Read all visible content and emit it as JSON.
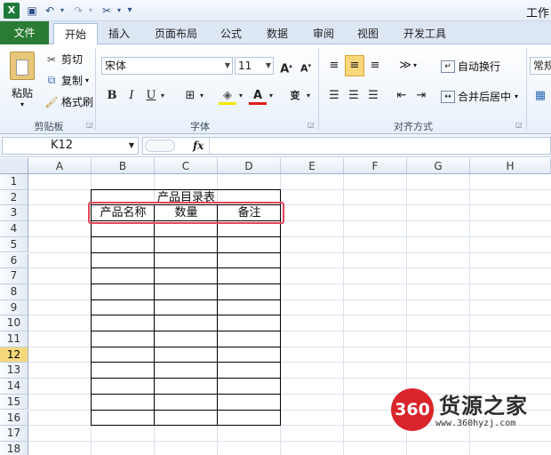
{
  "title_partial": "工作",
  "tabs": {
    "file": "文件",
    "home": "开始",
    "insert": "插入",
    "page_layout": "页面布局",
    "formulas": "公式",
    "data": "数据",
    "review": "审阅",
    "view": "视图",
    "developer": "开发工具"
  },
  "clipboard": {
    "paste": "粘贴",
    "cut": "剪切",
    "copy": "复制",
    "format_painter": "格式刷",
    "group": "剪贴板"
  },
  "font": {
    "name": "宋体",
    "size": "11",
    "bold": "B",
    "italic": "I",
    "underline": "U",
    "group": "字体",
    "grow": "A",
    "shrink": "A",
    "font_color": "A",
    "phonetic": "变"
  },
  "alignment": {
    "wrap_text": "自动换行",
    "merge_center": "合并后居中",
    "group": "对齐方式"
  },
  "number": {
    "format": "常规"
  },
  "formula_bar": {
    "name_box": "K12",
    "fx": "fx",
    "formula": ""
  },
  "columns": [
    "A",
    "B",
    "C",
    "D",
    "E",
    "F",
    "G",
    "H"
  ],
  "rows": [
    "1",
    "2",
    "3",
    "4",
    "5",
    "6",
    "7",
    "8",
    "9",
    "10",
    "11",
    "12",
    "13",
    "14",
    "15",
    "16",
    "17",
    "18"
  ],
  "selected_row": "12",
  "sheet": {
    "table_title": "产品目录表",
    "headers": [
      "产品名称",
      "数量",
      "备注"
    ]
  },
  "watermark": {
    "badge": "360",
    "title": "货源之家",
    "url": "www.360hyzj.com"
  },
  "colors": {
    "file_tab": "#2a7b33",
    "highlight_box": "#e3455a",
    "selected_row": "#f8d87c",
    "watermark_red": "#d9242c"
  }
}
